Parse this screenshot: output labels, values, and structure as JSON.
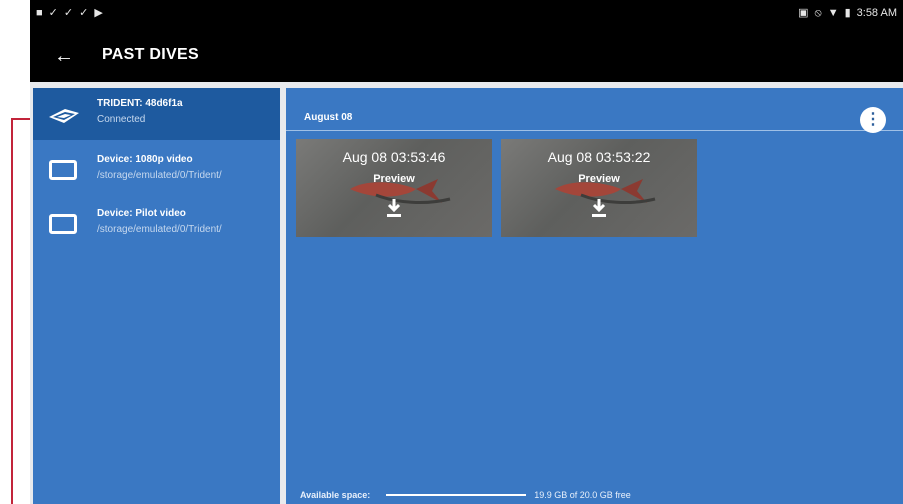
{
  "status_bar": {
    "left_icons": [
      "video-icon",
      "check-icon",
      "check-icon",
      "check-icon",
      "play-store-icon"
    ],
    "right_icons": [
      "cast-icon",
      "do-not-disturb-icon",
      "wifi-icon",
      "battery-icon"
    ],
    "time": "3:58 AM"
  },
  "app_bar": {
    "back_icon": "arrow-left-icon",
    "title": "PAST DIVES"
  },
  "sidebar": {
    "items": [
      {
        "title": "TRIDENT: 48d6f1a",
        "subtitle": "Connected",
        "icon": "drone-icon",
        "active": true
      },
      {
        "title": "Device: 1080p video",
        "subtitle": "/storage/emulated/0/Trident/",
        "icon": "folder-box-icon",
        "active": false
      },
      {
        "title": "Device: Pilot video",
        "subtitle": "/storage/emulated/0/Trident/",
        "icon": "folder-box-icon",
        "active": false
      }
    ]
  },
  "main": {
    "section_title": "August 08",
    "menu_icon": "more-vertical-icon",
    "videos": [
      {
        "time": "Aug 08 03:53:46",
        "preview_label": "Preview",
        "download_icon": "download-icon"
      },
      {
        "time": "Aug 08 03:53:22",
        "preview_label": "Preview",
        "download_icon": "download-icon"
      }
    ],
    "footer": {
      "label": "Available space:",
      "value": "19.9 GB of 20.0 GB free"
    }
  },
  "colors": {
    "panel_blue": "#3a78c3",
    "active_blue": "#1e5a9f",
    "annotation_red": "#c2243a"
  }
}
